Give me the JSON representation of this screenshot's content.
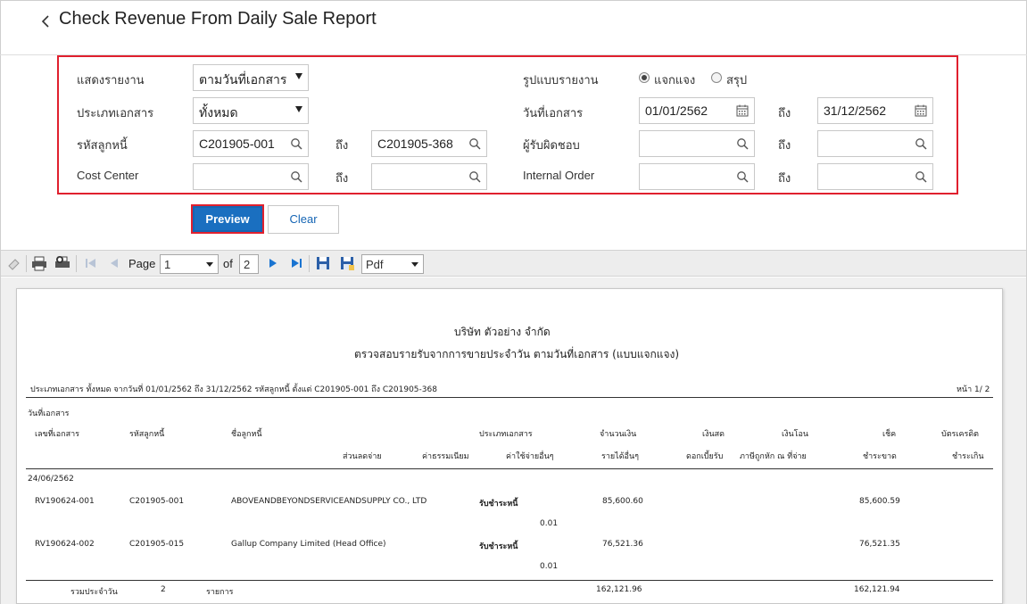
{
  "header": {
    "title": "Check Revenue From Daily Sale Report"
  },
  "filters": {
    "show_report": {
      "label": "แสดงรายงาน",
      "value": "ตามวันที่เอกสาร"
    },
    "report_format": {
      "label": "รูปแบบรายงาน",
      "options": [
        "แจกแจง",
        "สรุป"
      ],
      "selected": "แจกแจง"
    },
    "doc_type": {
      "label": "ประเภทเอกสาร",
      "value": "ทั้งหมด"
    },
    "doc_date": {
      "label": "วันที่เอกสาร",
      "from": "01/01/2562",
      "to_label": "ถึง",
      "to": "31/12/2562"
    },
    "debtor_code": {
      "label": "รหัสลูกหนี้",
      "from": "C201905-001",
      "to_label": "ถึง",
      "to": "C201905-368"
    },
    "responsible": {
      "label": "ผู้รับผิดชอบ",
      "from": "",
      "to_label": "ถึง",
      "to": ""
    },
    "cost_center": {
      "label": "Cost Center",
      "from": "",
      "to_label": "ถึง",
      "to": ""
    },
    "internal_order": {
      "label": "Internal Order",
      "from": "",
      "to_label": "ถึง",
      "to": ""
    }
  },
  "actions": {
    "preview": "Preview",
    "clear": "Clear"
  },
  "toolbar": {
    "page_label": "Page",
    "page_value": "1",
    "of_label": "of",
    "total_pages": "2",
    "export_format": "Pdf",
    "icons": [
      "bookmark-icon",
      "print-icon",
      "print-preview-icon",
      "first-page-icon",
      "previous-page-icon",
      "next-page-icon",
      "last-page-icon",
      "save-icon",
      "save-as-icon"
    ]
  },
  "report": {
    "company": "บริษัท ตัวอย่าง จำกัด",
    "title": "ตรวจสอบรายรับจากการขายประจำวัน ตามวันที่เอกสาร (แบบแจกแจง)",
    "criteria": "ประเภทเอกสาร ทั้งหมด จากวันที่ 01/01/2562 ถึง 31/12/2562 รหัสลูกหนี้ ตั้งแต่ C201905-001 ถึง C201905-368",
    "page_no": "หน้า 1/ 2",
    "headers": {
      "doc_date": "วันที่เอกสาร",
      "doc_no": "เลขที่เอกสาร",
      "debtor_code": "รหัสลูกหนี้",
      "debtor_name": "ชื่อลูกหนี้",
      "doc_type": "ประเภทเอกสาร",
      "amount": "จำนวนเงิน",
      "cash": "เงินสด",
      "transfer": "เงินโอน",
      "cheque": "เช็ค",
      "credit_card": "บัตรเครดิต",
      "discount": "ส่วนลดจ่าย",
      "fee": "ค่าธรรมเนียม",
      "other_expense": "ค่าใช้จ่ายอื่นๆ",
      "other_income": "รายได้อื่นๆ",
      "interest": "ดอกเบี้ยรับ",
      "wht": "ภาษีถูกหัก ณ ที่จ่าย",
      "cheque_overdue": "ชำระขาด",
      "card_excess": "ชำระเกิน"
    },
    "group_date": "24/06/2562",
    "rows": [
      {
        "doc_no": "RV190624-001",
        "debtor_code": "C201905-001",
        "debtor_name": "ABOVEANDBEYONDSERVICEANDSUPPLY CO., LTD",
        "doc_type": "รับชำระหนี้",
        "amount": "85,600.60",
        "cheque": "85,600.59",
        "other_expense": "0.01"
      },
      {
        "doc_no": "RV190624-002",
        "debtor_code": "C201905-015",
        "debtor_name": "Gallup Company Limited (Head Office)",
        "doc_type": "รับชำระหนี้",
        "amount": "76,521.36",
        "cheque": "76,521.35",
        "other_expense": "0.01"
      }
    ],
    "summary": {
      "label": "รวมประจำวัน",
      "count": "2",
      "unit": "รายการ",
      "amount": "162,121.96",
      "cheque": "162,121.94"
    }
  }
}
